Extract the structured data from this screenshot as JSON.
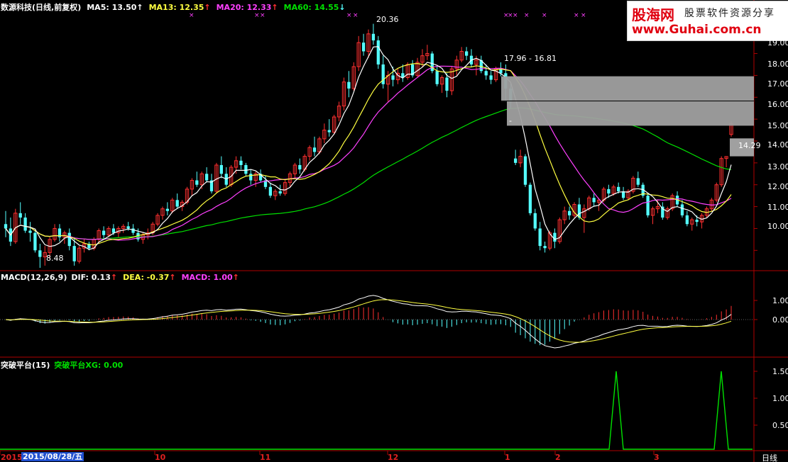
{
  "main_legend": {
    "stock_label": "数源科技(日线,前复权)",
    "ma5": "MA5: 13.50",
    "ma13": "MA13: 12.35",
    "ma20": "MA20: 12.33",
    "ma60": "MA60: 14.55",
    "ma5_arrow": "↑",
    "ma13_arrow": "↑",
    "ma20_arrow": "↑",
    "ma60_arrow": "↓"
  },
  "macd_legend": {
    "title": "MACD(12,26,9)",
    "dif": "DIF: 0.13",
    "dea": "DEA: -0.37",
    "macd": "MACD: 1.00",
    "dif_arrow": "↑",
    "dea_arrow": "↑",
    "macd_arrow": "↑"
  },
  "breakout_legend": {
    "title": "突破平台(15)",
    "xg": "突破平台XG: 0.00"
  },
  "watermark": {
    "brand": "股海网",
    "slogan": "股票软件资源分享",
    "url": "www.Guhai.com.cn"
  },
  "annotations": {
    "high": "20.36",
    "low": "8.48",
    "range": "17.96 - 16.81",
    "last": "14.29",
    "dash": "-"
  },
  "price_axis": [
    "19.00",
    "18.00",
    "17.00",
    "16.00",
    "15.00",
    "14.00",
    "13.00",
    "12.00",
    "11.00",
    "10.00"
  ],
  "macd_axis": [
    "1.00",
    "0.00"
  ],
  "xg_axis": [
    "1.50",
    "1.00",
    "0.50"
  ],
  "time_axis": {
    "year": "2015",
    "cursor_date": "2015/08/28/五",
    "months": [
      "10",
      "11",
      "12",
      "1",
      "2",
      "3"
    ],
    "period": "日线"
  },
  "colors": {
    "up": "#ff3030",
    "down": "#54ffff",
    "ma5": "#ffffff",
    "ma13": "#ffff40",
    "ma20": "#ff40ff",
    "ma60": "#00e000",
    "frame": "#b00000"
  },
  "chart_data": {
    "type": "candlestick",
    "ylim": [
      9.2,
      20.8
    ],
    "ohlc": [
      [
        11.2,
        11.8,
        10.6,
        11.0
      ],
      [
        11.0,
        11.5,
        10.2,
        10.4
      ],
      [
        10.4,
        11.9,
        10.3,
        11.7
      ],
      [
        11.7,
        12.2,
        11.2,
        11.5
      ],
      [
        11.5,
        11.7,
        10.8,
        10.9
      ],
      [
        10.9,
        11.3,
        10.4,
        10.8
      ],
      [
        10.8,
        10.9,
        9.9,
        10.0
      ],
      [
        10.0,
        10.3,
        9.2,
        9.7
      ],
      [
        9.7,
        10.2,
        9.3,
        9.9
      ],
      [
        9.9,
        10.6,
        9.6,
        10.5
      ],
      [
        10.5,
        11.2,
        10.4,
        11.0
      ],
      [
        11.0,
        11.2,
        10.4,
        10.6
      ],
      [
        10.6,
        10.9,
        10.3,
        10.8
      ],
      [
        10.8,
        11.0,
        10.0,
        10.2
      ],
      [
        10.2,
        10.6,
        9.3,
        9.5
      ],
      [
        9.5,
        10.2,
        9.4,
        10.1
      ],
      [
        10.1,
        10.5,
        9.9,
        10.3
      ],
      [
        10.3,
        10.4,
        10.0,
        10.1
      ],
      [
        10.1,
        10.6,
        10.0,
        10.5
      ],
      [
        10.5,
        11.0,
        10.3,
        10.9
      ],
      [
        10.9,
        11.1,
        10.5,
        10.7
      ],
      [
        10.7,
        11.1,
        10.6,
        11.0
      ],
      [
        11.0,
        11.2,
        10.7,
        10.8
      ],
      [
        10.8,
        11.1,
        10.6,
        11.0
      ],
      [
        11.0,
        11.2,
        10.8,
        11.1
      ],
      [
        11.1,
        11.3,
        10.9,
        11.0
      ],
      [
        11.0,
        11.2,
        10.7,
        10.8
      ],
      [
        10.8,
        11.0,
        10.4,
        10.5
      ],
      [
        10.5,
        10.8,
        10.3,
        10.7
      ],
      [
        10.7,
        11.0,
        10.5,
        10.8
      ],
      [
        10.8,
        11.3,
        10.7,
        11.2
      ],
      [
        11.2,
        11.7,
        11.1,
        11.6
      ],
      [
        11.6,
        12.0,
        11.4,
        11.9
      ],
      [
        11.9,
        12.2,
        11.6,
        11.8
      ],
      [
        11.8,
        12.4,
        11.7,
        12.3
      ],
      [
        12.3,
        12.6,
        11.9,
        12.0
      ],
      [
        12.0,
        12.3,
        11.8,
        12.2
      ],
      [
        12.2,
        12.9,
        12.1,
        12.8
      ],
      [
        12.8,
        13.3,
        12.5,
        13.2
      ],
      [
        13.2,
        13.6,
        12.9,
        13.0
      ],
      [
        13.0,
        13.6,
        12.8,
        13.5
      ],
      [
        13.5,
        13.8,
        13.1,
        13.2
      ],
      [
        13.2,
        13.5,
        12.6,
        12.7
      ],
      [
        12.7,
        14.0,
        12.6,
        13.9
      ],
      [
        13.9,
        14.3,
        13.3,
        13.5
      ],
      [
        13.5,
        13.8,
        12.9,
        13.0
      ],
      [
        13.0,
        13.9,
        12.9,
        13.8
      ],
      [
        13.8,
        14.3,
        13.5,
        14.1
      ],
      [
        14.1,
        14.3,
        13.7,
        13.9
      ],
      [
        13.9,
        14.0,
        13.4,
        13.5
      ],
      [
        13.5,
        13.7,
        13.0,
        13.2
      ],
      [
        13.2,
        13.6,
        12.9,
        13.5
      ],
      [
        13.5,
        13.7,
        13.1,
        13.2
      ],
      [
        13.2,
        13.4,
        12.8,
        12.9
      ],
      [
        12.9,
        13.1,
        12.4,
        12.5
      ],
      [
        12.5,
        12.8,
        12.3,
        12.7
      ],
      [
        12.7,
        13.0,
        12.5,
        12.6
      ],
      [
        12.6,
        13.2,
        12.5,
        13.1
      ],
      [
        13.1,
        13.6,
        12.9,
        13.5
      ],
      [
        13.5,
        14.0,
        13.3,
        13.9
      ],
      [
        13.9,
        14.2,
        13.5,
        13.7
      ],
      [
        13.7,
        14.4,
        13.6,
        14.3
      ],
      [
        14.3,
        14.8,
        14.1,
        14.7
      ],
      [
        14.7,
        15.2,
        14.3,
        14.5
      ],
      [
        14.5,
        15.2,
        14.4,
        15.1
      ],
      [
        15.1,
        15.8,
        14.9,
        15.5
      ],
      [
        15.5,
        16.0,
        15.2,
        15.4
      ],
      [
        15.4,
        16.2,
        15.3,
        16.1
      ],
      [
        16.1,
        16.8,
        15.9,
        16.6
      ],
      [
        16.6,
        17.9,
        16.4,
        17.7
      ],
      [
        17.7,
        18.2,
        17.0,
        17.4
      ],
      [
        17.4,
        18.6,
        17.3,
        18.4
      ],
      [
        18.4,
        19.8,
        18.2,
        19.5
      ],
      [
        19.5,
        19.9,
        18.9,
        19.1
      ],
      [
        19.1,
        20.1,
        18.8,
        19.9
      ],
      [
        19.9,
        20.36,
        19.4,
        19.6
      ],
      [
        19.6,
        19.8,
        18.3,
        18.5
      ],
      [
        18.5,
        18.9,
        17.4,
        17.6
      ],
      [
        17.6,
        18.2,
        16.8,
        18.0
      ],
      [
        18.0,
        18.4,
        17.5,
        17.8
      ],
      [
        17.8,
        18.3,
        17.6,
        18.1
      ],
      [
        18.1,
        18.5,
        17.7,
        17.9
      ],
      [
        17.9,
        18.6,
        17.8,
        18.5
      ],
      [
        18.5,
        18.7,
        17.9,
        18.0
      ],
      [
        18.0,
        18.8,
        17.9,
        18.6
      ],
      [
        18.6,
        19.2,
        18.4,
        18.9
      ],
      [
        18.9,
        19.4,
        18.7,
        19.0
      ],
      [
        19.0,
        19.1,
        18.1,
        18.2
      ],
      [
        18.2,
        18.4,
        17.5,
        17.6
      ],
      [
        17.6,
        18.0,
        17.2,
        17.9
      ],
      [
        17.9,
        18.1,
        17.0,
        17.3
      ],
      [
        17.3,
        18.4,
        17.1,
        18.3
      ],
      [
        18.3,
        18.9,
        18.0,
        18.7
      ],
      [
        18.7,
        19.3,
        18.6,
        19.1
      ],
      [
        19.1,
        19.3,
        18.7,
        18.9
      ],
      [
        18.9,
        19.2,
        18.4,
        18.5
      ],
      [
        18.5,
        18.9,
        18.0,
        18.7
      ],
      [
        18.7,
        18.9,
        18.1,
        18.2
      ],
      [
        18.2,
        18.5,
        17.8,
        18.0
      ],
      [
        18.0,
        18.2,
        17.6,
        17.8
      ],
      [
        17.8,
        18.4,
        17.7,
        18.3
      ],
      [
        18.3,
        18.6,
        17.96,
        18.1
      ],
      [
        18.1,
        18.5,
        16.81,
        17.4
      ],
      [
        17.4,
        17.6,
        16.5,
        16.8
      ],
      [
        14.2,
        14.6,
        13.9,
        14.0
      ],
      [
        14.0,
        14.6,
        13.8,
        14.3
      ],
      [
        14.3,
        14.4,
        12.9,
        13.0
      ],
      [
        13.0,
        13.1,
        11.6,
        11.7
      ],
      [
        11.7,
        11.9,
        10.9,
        11.0
      ],
      [
        11.0,
        11.3,
        10.0,
        10.2
      ],
      [
        10.2,
        10.4,
        9.9,
        10.1
      ],
      [
        10.1,
        10.9,
        10.0,
        10.8
      ],
      [
        10.8,
        11.0,
        10.1,
        10.4
      ],
      [
        10.4,
        11.5,
        10.3,
        11.4
      ],
      [
        11.4,
        12.0,
        11.2,
        11.8
      ],
      [
        11.8,
        12.0,
        11.4,
        11.6
      ],
      [
        11.6,
        12.2,
        11.5,
        12.1
      ],
      [
        12.1,
        12.4,
        11.4,
        11.5
      ],
      [
        11.5,
        12.1,
        10.8,
        11.9
      ],
      [
        11.9,
        12.5,
        11.8,
        12.4
      ],
      [
        12.4,
        12.6,
        12.0,
        12.2
      ],
      [
        12.2,
        12.4,
        11.8,
        12.3
      ],
      [
        12.3,
        12.9,
        12.2,
        12.8
      ],
      [
        12.8,
        13.0,
        12.4,
        12.6
      ],
      [
        12.6,
        13.0,
        12.5,
        12.9
      ],
      [
        12.9,
        13.1,
        12.6,
        12.7
      ],
      [
        12.7,
        12.9,
        12.3,
        12.4
      ],
      [
        12.4,
        12.8,
        12.3,
        12.7
      ],
      [
        12.7,
        13.4,
        12.6,
        13.3
      ],
      [
        13.3,
        13.6,
        12.9,
        13.0
      ],
      [
        13.0,
        13.1,
        12.4,
        12.5
      ],
      [
        12.5,
        12.6,
        11.5,
        11.6
      ],
      [
        11.6,
        12.0,
        11.2,
        11.9
      ],
      [
        11.9,
        12.3,
        11.7,
        12.0
      ],
      [
        12.0,
        12.2,
        11.4,
        11.5
      ],
      [
        11.5,
        12.0,
        11.4,
        11.9
      ],
      [
        11.9,
        12.6,
        11.8,
        12.5
      ],
      [
        12.5,
        12.7,
        12.0,
        12.1
      ],
      [
        12.1,
        12.3,
        11.5,
        11.6
      ],
      [
        11.6,
        11.8,
        11.1,
        11.2
      ],
      [
        11.2,
        11.5,
        10.9,
        11.4
      ],
      [
        11.4,
        11.6,
        11.1,
        11.3
      ],
      [
        11.3,
        11.7,
        11.0,
        11.6
      ],
      [
        11.6,
        12.0,
        11.5,
        11.9
      ],
      [
        11.9,
        12.4,
        11.8,
        12.3
      ],
      [
        12.3,
        13.1,
        12.2,
        13.0
      ],
      [
        13.0,
        14.3,
        12.9,
        14.2
      ],
      [
        14.2,
        14.3,
        13.8,
        14.29
      ],
      [
        15.3,
        15.9,
        15.2,
        15.8
      ]
    ]
  }
}
